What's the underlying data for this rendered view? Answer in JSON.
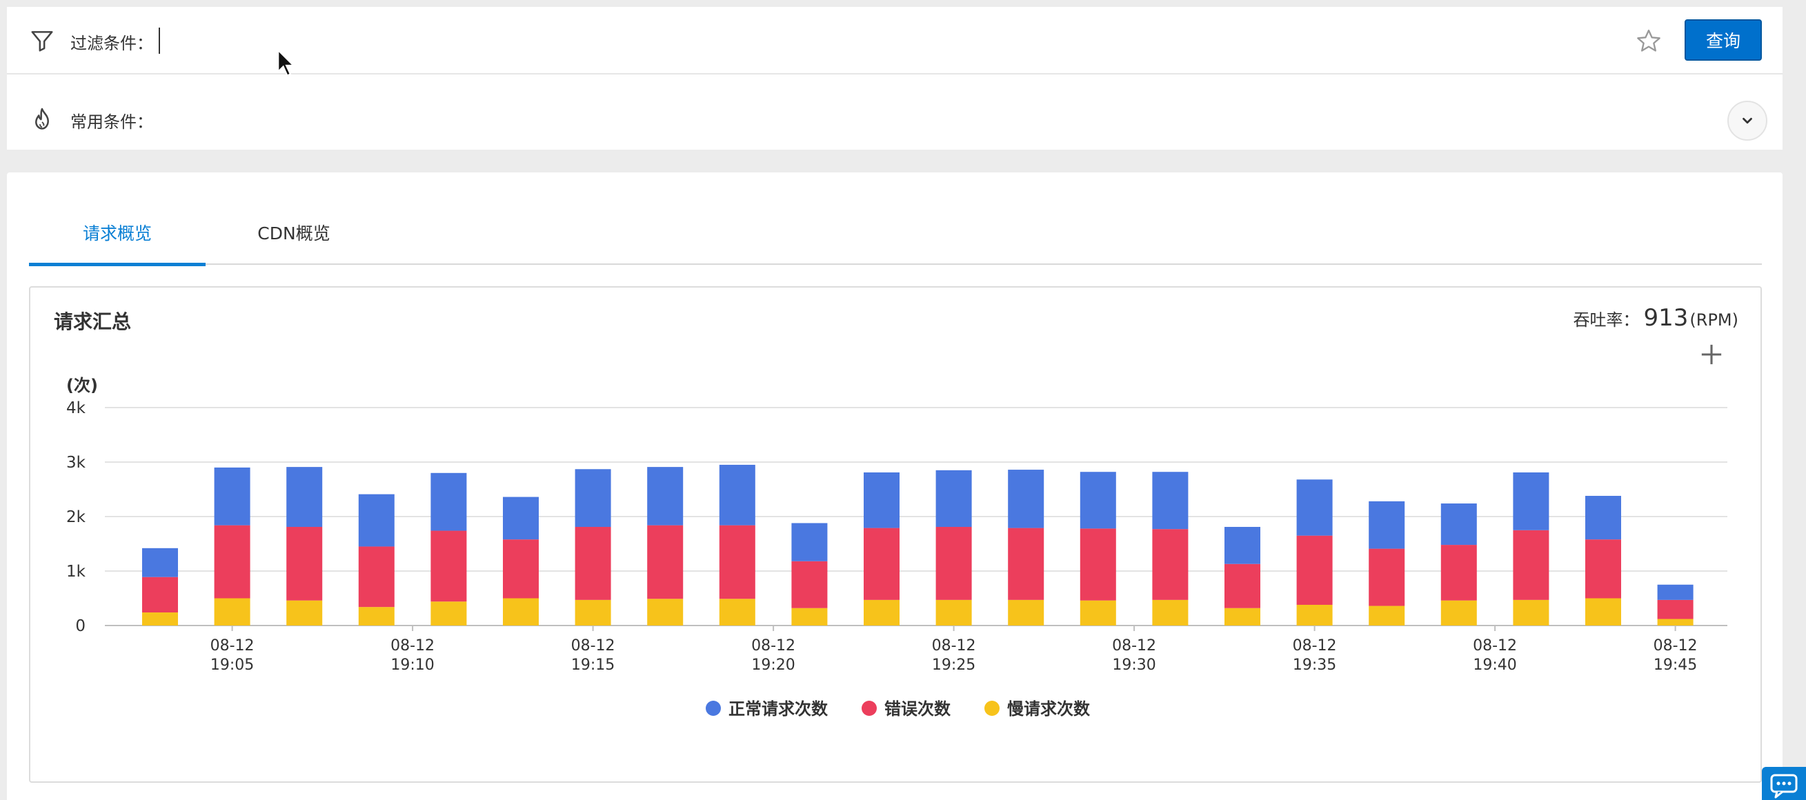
{
  "filter": {
    "label": "过滤条件：",
    "common_label": "常用条件：",
    "query_button": "查询"
  },
  "tabs": [
    {
      "label": "请求概览",
      "active": true
    },
    {
      "label": "CDN概览",
      "active": false
    }
  ],
  "card": {
    "title": "请求汇总",
    "throughput_label": "吞吐率：",
    "throughput_value": "913",
    "throughput_unit": "(RPM)"
  },
  "colors": {
    "normal": "#4a78e0",
    "error": "#ec3e5c",
    "slow": "#f7c31b",
    "accent": "#0a7fd4"
  },
  "chart_data": {
    "type": "bar",
    "stacked": true,
    "y_unit": "(次)",
    "ylim": [
      0,
      4000
    ],
    "yticks": [
      "0",
      "1k",
      "2k",
      "3k",
      "4k"
    ],
    "ytick_values": [
      0,
      1000,
      2000,
      3000,
      4000
    ],
    "xtick_labels": [
      [
        "08-12",
        "19:05"
      ],
      [
        "08-12",
        "19:10"
      ],
      [
        "08-12",
        "19:15"
      ],
      [
        "08-12",
        "19:20"
      ],
      [
        "08-12",
        "19:25"
      ],
      [
        "08-12",
        "19:30"
      ],
      [
        "08-12",
        "19:35"
      ],
      [
        "08-12",
        "19:40"
      ],
      [
        "08-12",
        "19:45"
      ]
    ],
    "xtick_bar_index": [
      1,
      3.5,
      6,
      8.5,
      11,
      13.5,
      16,
      18.5,
      21
    ],
    "legend_position": "bottom-center",
    "grid": true,
    "series": [
      {
        "name": "正常请求次数",
        "color": "#4a78e0",
        "values": [
          530,
          1060,
          1100,
          960,
          1060,
          780,
          1060,
          1070,
          1110,
          700,
          1020,
          1040,
          1070,
          1040,
          1050,
          680,
          1030,
          870,
          760,
          1060,
          800,
          280
        ]
      },
      {
        "name": "错误次数",
        "color": "#ec3e5c",
        "values": [
          650,
          1340,
          1350,
          1110,
          1300,
          1080,
          1340,
          1350,
          1350,
          860,
          1320,
          1340,
          1320,
          1320,
          1300,
          810,
          1270,
          1050,
          1020,
          1280,
          1080,
          350
        ]
      },
      {
        "name": "慢请求次数",
        "color": "#f7c31b",
        "values": [
          240,
          500,
          460,
          340,
          440,
          500,
          470,
          490,
          490,
          320,
          470,
          470,
          470,
          460,
          470,
          320,
          380,
          360,
          460,
          470,
          500,
          120
        ]
      }
    ]
  }
}
